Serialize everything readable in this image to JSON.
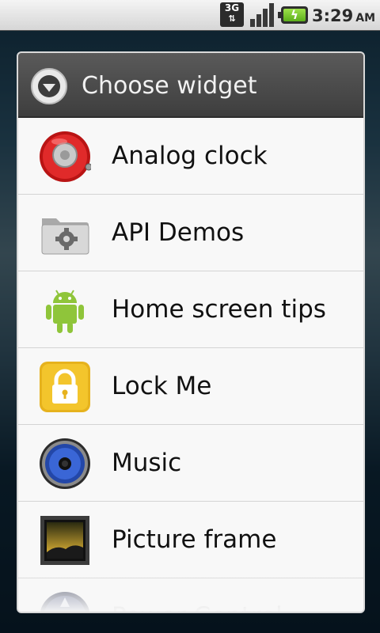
{
  "status_bar": {
    "network_type": "3G",
    "time": "3:29",
    "ampm": "AM",
    "signal_bars": 4,
    "battery": "charging"
  },
  "dialog": {
    "title": "Choose widget",
    "items": [
      {
        "label": "Analog clock",
        "icon": "analog-clock-icon"
      },
      {
        "label": "API Demos",
        "icon": "folder-gear-icon"
      },
      {
        "label": "Home screen tips",
        "icon": "android-icon"
      },
      {
        "label": "Lock Me",
        "icon": "padlock-icon"
      },
      {
        "label": "Music",
        "icon": "speaker-icon"
      },
      {
        "label": "Picture frame",
        "icon": "picture-frame-icon"
      },
      {
        "label": "Power Control",
        "icon": "power-control-icon"
      }
    ]
  },
  "colors": {
    "header_bg": "#4a4a4a",
    "list_bg": "#f8f8f8",
    "divider": "#d4d4d4",
    "battery_green": "#7ccf2f"
  }
}
